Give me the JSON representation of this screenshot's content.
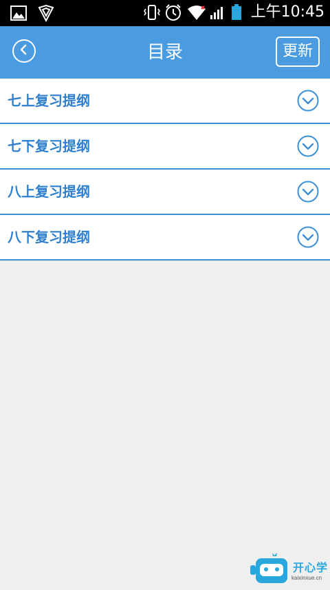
{
  "status_bar": {
    "time": "上午10:45",
    "icons": [
      "image-icon",
      "shield-icon",
      "vibrate-icon",
      "alarm-icon",
      "wifi-icon",
      "signal-icon",
      "battery-icon"
    ]
  },
  "header": {
    "title": "目录",
    "update_label": "更新",
    "back_icon": "back-circle-icon"
  },
  "list": {
    "items": [
      {
        "label": "七上复习提纲",
        "icon": "chevron-down-circle-icon"
      },
      {
        "label": "七下复习提纲",
        "icon": "chevron-down-circle-icon"
      },
      {
        "label": "八上复习提纲",
        "icon": "chevron-down-circle-icon"
      },
      {
        "label": "八下复习提纲",
        "icon": "chevron-down-circle-icon"
      }
    ]
  },
  "watermark": {
    "name": "开心学",
    "url": "kaixinxue.cn"
  },
  "colors": {
    "header_bg": "#4a9be0",
    "accent": "#2f7fcf",
    "background": "#efefef"
  }
}
